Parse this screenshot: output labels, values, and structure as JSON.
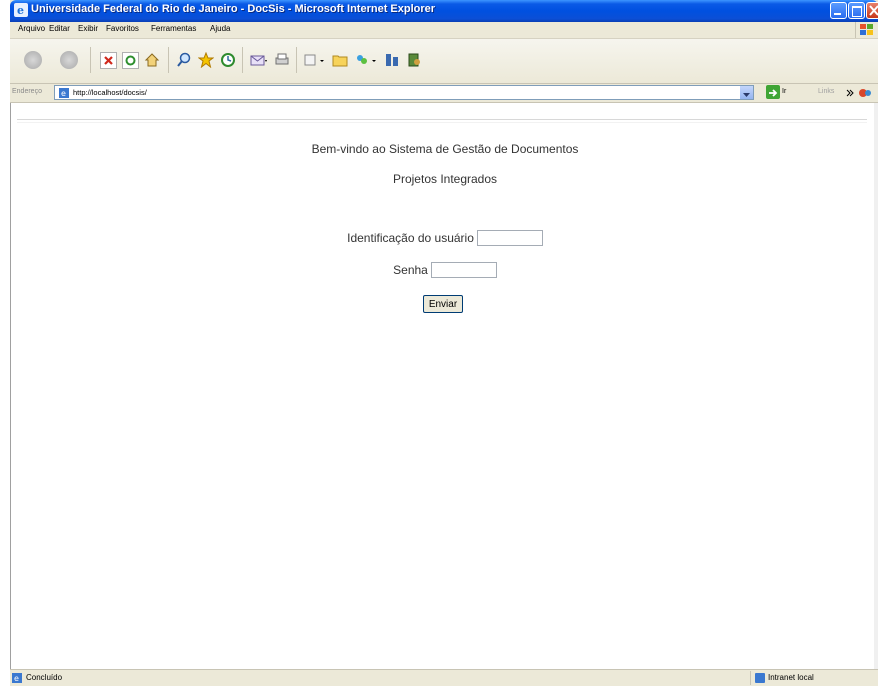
{
  "window": {
    "title": "Universidade Federal do Rio de Janeiro - DocSis - Microsoft Internet Explorer"
  },
  "menu": {
    "items": [
      "Arquivo",
      "Editar",
      "Exibir",
      "Favoritos",
      "Ferramentas",
      "Ajuda"
    ]
  },
  "toolbar": {
    "icons": [
      "back-icon",
      "forward-icon",
      "stop-icon",
      "refresh-icon",
      "home-icon",
      "search-icon",
      "favorites-icon",
      "history-icon",
      "mail-icon",
      "print-icon",
      "edit-icon",
      "folder-icon",
      "messenger-icon",
      "discuss-icon",
      "research-icon"
    ]
  },
  "address": {
    "label": "Endereço",
    "url": "http://localhost/docsis/",
    "go_label": "Ir",
    "links_label": "Links"
  },
  "page": {
    "welcome": "Bem-vindo ao Sistema de Gestão de Documentos",
    "subtitle": "Projetos Integrados",
    "user_label": "Identificação do usuário",
    "user_value": "",
    "password_label": "Senha",
    "password_value": "",
    "submit_label": "Enviar"
  },
  "status": {
    "text": "Concluído",
    "zone": "Intranet local"
  },
  "colors": {
    "titlebar": "#0050e0",
    "chrome": "#ece9d8",
    "text": "#333333"
  }
}
